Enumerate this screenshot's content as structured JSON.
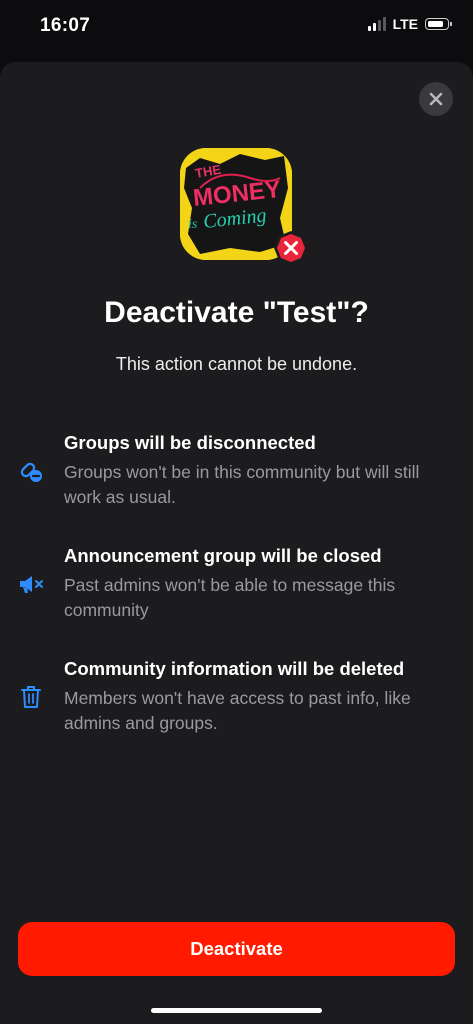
{
  "status_bar": {
    "time": "16:07",
    "network": "LTE",
    "signal_bars_active": 2,
    "signal_bars_total": 4,
    "battery_level": 0.75
  },
  "sheet": {
    "close_icon": "close-icon",
    "community_image_text": [
      "THE",
      "MONEY",
      "is",
      "Coming"
    ],
    "badge_icon": "x-circle-badge-icon",
    "title": "Deactivate \"Test\"?",
    "subtitle": "This action cannot be undone.",
    "items": [
      {
        "icon": "broken-link-icon",
        "title": "Groups will be disconnected",
        "description": "Groups won't be in this community but will still work as usual."
      },
      {
        "icon": "megaphone-muted-icon",
        "title": "Announcement group will be closed",
        "description": "Past admins won't be able to message this community"
      },
      {
        "icon": "trash-icon",
        "title": "Community information will be deleted",
        "description": "Members won't have access to past info, like admins and groups."
      }
    ],
    "deactivate_button": "Deactivate"
  },
  "colors": {
    "accent_blue": "#2f8cff",
    "danger_red": "#ff1a00",
    "sheet_bg": "#1c1c1e"
  }
}
